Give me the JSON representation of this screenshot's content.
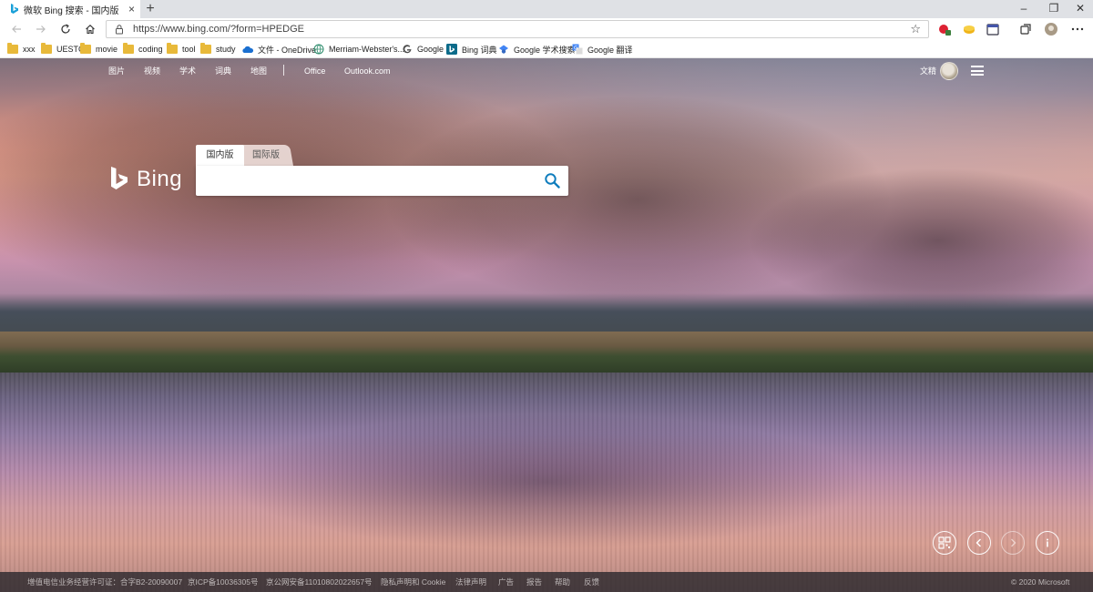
{
  "browser": {
    "tab": {
      "title": "微软 Bing 搜索 - 国内版",
      "close_glyph": "×",
      "favicon": "bing-favicon"
    },
    "new_tab_glyph": "+",
    "window_controls": {
      "minimize": "–",
      "restore": "❐",
      "close": "✕"
    },
    "address": {
      "url": "https://www.bing.com/?form=HPEDGE",
      "star_glyph": "☆"
    },
    "bookmarks": [
      {
        "label": "xxx",
        "icon": "folder-icon"
      },
      {
        "label": "UESTC",
        "icon": "folder-icon"
      },
      {
        "label": "movie",
        "icon": "folder-icon"
      },
      {
        "label": "coding",
        "icon": "folder-icon"
      },
      {
        "label": "tool",
        "icon": "folder-icon"
      },
      {
        "label": "study",
        "icon": "folder-icon"
      },
      {
        "label": "文件 - OneDrive",
        "icon": "onedrive-icon"
      },
      {
        "label": "Merriam-Webster's...",
        "icon": "globe-icon"
      },
      {
        "label": "Google",
        "icon": "google-icon"
      },
      {
        "label": "Bing 词典",
        "icon": "bing-icon"
      },
      {
        "label": "Google 学术搜索",
        "icon": "scholar-icon"
      },
      {
        "label": "Google 翻译",
        "icon": "translate-icon"
      }
    ]
  },
  "bing": {
    "nav": [
      "图片",
      "视频",
      "学术",
      "词典",
      "地图",
      "Office",
      "Outlook.com"
    ],
    "user_name": "文精",
    "logo_text": "Bing",
    "scopes": {
      "active": "国内版",
      "inactive": "国际版"
    },
    "search": {
      "value": "",
      "placeholder": ""
    },
    "footer": {
      "links": [
        "增值电信业务经营许可证：合字B2-20090007",
        "京ICP备10036305号",
        "京公网安备11010802022657号",
        "隐私声明和 Cookie",
        "法律声明",
        "广告",
        "报告",
        "帮助",
        "反馈"
      ],
      "copyright": "© 2020 Microsoft"
    }
  },
  "colors": {
    "bing_blue": "#0c8484",
    "search_icon": "#0f7dbd",
    "footer_bg": "#2d2a2e"
  }
}
